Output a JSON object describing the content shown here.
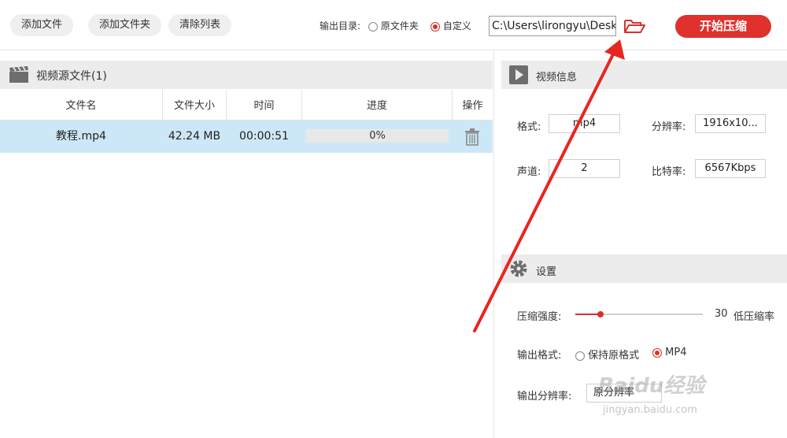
{
  "toolbar": {
    "add_file": "添加文件",
    "add_folder": "添加文件夹",
    "clear_list": "清除列表",
    "output_dir_label": "输出目录:",
    "option_source_folder": "原文件夹",
    "option_custom": "自定义",
    "selected_option": "自定义",
    "output_path": "C:\\Users\\lirongyu\\Desk",
    "start_label": "开始压缩"
  },
  "source_panel": {
    "title": "视频源文件(1)",
    "columns": [
      "文件名",
      "文件大小",
      "时间",
      "进度",
      "操作"
    ],
    "rows": [
      {
        "name": "教程.mp4",
        "size": "42.24 MB",
        "duration": "00:00:51",
        "progress_text": "0%",
        "progress": 0
      }
    ]
  },
  "video_info": {
    "title": "视频信息",
    "format_label": "格式:",
    "format_value": "mp4",
    "resolution_label": "分辨率:",
    "resolution_value": "1916x10...",
    "channels_label": "声道:",
    "channels_value": "2",
    "bitrate_label": "比特率:",
    "bitrate_value": "6567Kbps"
  },
  "settings": {
    "title": "设置",
    "strength_label": "压缩强度:",
    "strength_value": "30",
    "strength_hint": "低压缩率",
    "strength_fraction": 0.2,
    "format_label": "输出格式:",
    "format_option_keep": "保持原格式",
    "format_option_mp4": "MP4",
    "format_selected": "MP4",
    "resolution_label": "输出分辨率:",
    "resolution_value": "原分辨率"
  },
  "watermark": {
    "brand": "Baidu经验",
    "url": "jingyan.baidu.com"
  },
  "colors": {
    "accent": "#e0312d",
    "row_highlight": "#cce8f6",
    "header_bg": "#ececec",
    "annotation_arrow": "#e8261f"
  }
}
